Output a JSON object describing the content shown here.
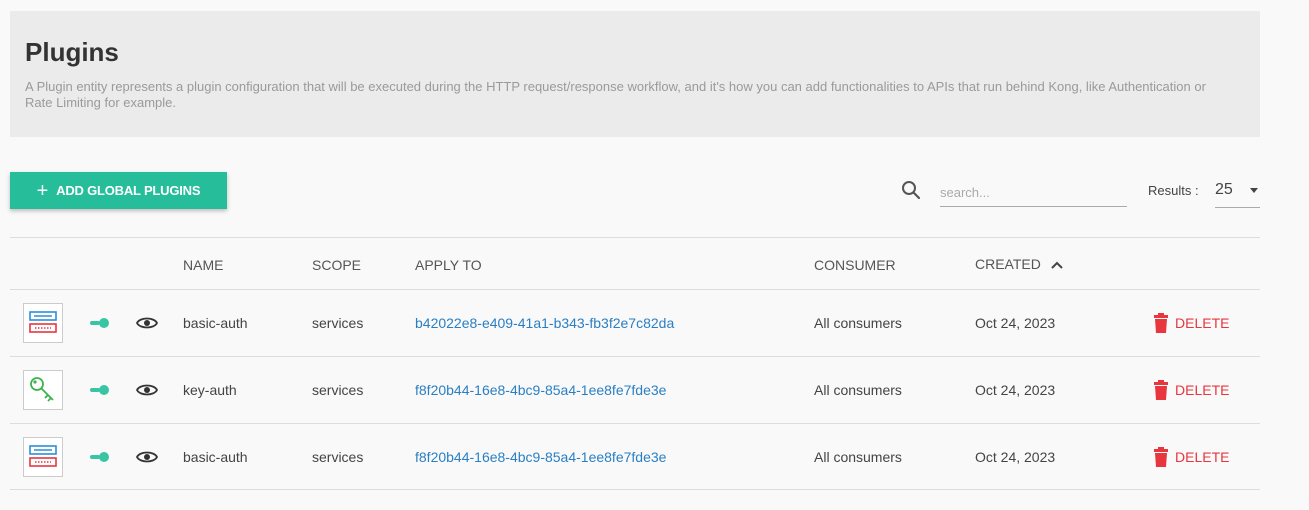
{
  "header": {
    "title": "Plugins",
    "description": "A Plugin entity represents a plugin configuration that will be executed during the HTTP request/response workflow, and it's how you can add functionalities to APIs that run behind Kong, like Authentication or Rate Limiting for example."
  },
  "toolbar": {
    "add_label": "ADD GLOBAL PLUGINS",
    "search_placeholder": "search...",
    "results_label": "Results :",
    "results_value": "25"
  },
  "table": {
    "columns": {
      "name": "NAME",
      "scope": "SCOPE",
      "apply_to": "APPLY TO",
      "consumer": "CONSUMER",
      "created": "CREATED"
    },
    "rows": [
      {
        "icon": "basic-auth-icon",
        "name": "basic-auth",
        "scope": "services",
        "apply_to": "b42022e8-e409-41a1-b343-fb3f2e7c82da",
        "consumer": "All consumers",
        "created": "Oct 24, 2023",
        "delete": "DELETE"
      },
      {
        "icon": "key-auth-icon",
        "name": "key-auth",
        "scope": "services",
        "apply_to": "f8f20b44-16e8-4bc9-85a4-1ee8fe7fde3e",
        "consumer": "All consumers",
        "created": "Oct 24, 2023",
        "delete": "DELETE"
      },
      {
        "icon": "basic-auth-icon",
        "name": "basic-auth",
        "scope": "services",
        "apply_to": "f8f20b44-16e8-4bc9-85a4-1ee8fe7fde3e",
        "consumer": "All consumers",
        "created": "Oct 24, 2023",
        "delete": "DELETE"
      }
    ]
  },
  "colors": {
    "accent": "#26bd9b",
    "link": "#2a7fc3",
    "danger": "#e8363f"
  }
}
